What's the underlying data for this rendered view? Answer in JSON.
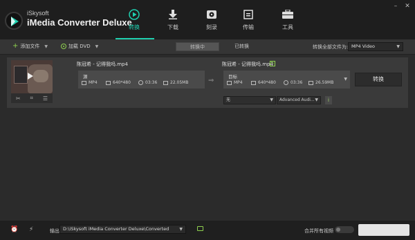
{
  "app": {
    "brand_small": "iSkysoft",
    "brand_big": "iMedia Converter Deluxe"
  },
  "nav": [
    {
      "label": "转换",
      "icon": "play-circle-icon",
      "active": true
    },
    {
      "label": "下载",
      "icon": "download-icon",
      "active": false
    },
    {
      "label": "刻录",
      "icon": "disc-icon",
      "active": false
    },
    {
      "label": "传输",
      "icon": "transfer-icon",
      "active": false
    },
    {
      "label": "工具",
      "icon": "toolbox-icon",
      "active": false
    }
  ],
  "window_controls": [
    "minimize",
    "close"
  ],
  "toolbar": {
    "add_files": "添加文件",
    "load_dvd": "加载 DVD",
    "tab_converting": "转换中",
    "tab_converted": "已转换",
    "convert_all_to_label": "转换全部文件为:",
    "convert_all_format": "MP4 Video"
  },
  "file": {
    "source_name": "陈冠希 - 记得我吗.mp4",
    "source_box_title": "源",
    "source_meta": {
      "format": "MP4",
      "resolution": "640*480",
      "duration": "03:36",
      "size": "22.05MB"
    },
    "target_name": "陈冠希 - 记得我吗.mp4",
    "target_box_title": "目标",
    "target_meta": {
      "format": "MP4",
      "resolution": "640*480",
      "duration": "03:36",
      "size": "26.59MB"
    },
    "convert_button": "转换",
    "subtitle_select": "无",
    "audio_select": "Advanced Audi...",
    "info_button": "i"
  },
  "bottom": {
    "output_label": "输出",
    "output_path": "D:\\iSkysoft iMedia Converter Deluxe\\Converted",
    "merge_label": "合并所有视频"
  },
  "colors": {
    "accent": "#1fd0b0",
    "green": "#8fd14f",
    "bg": "#2b2b2b"
  }
}
